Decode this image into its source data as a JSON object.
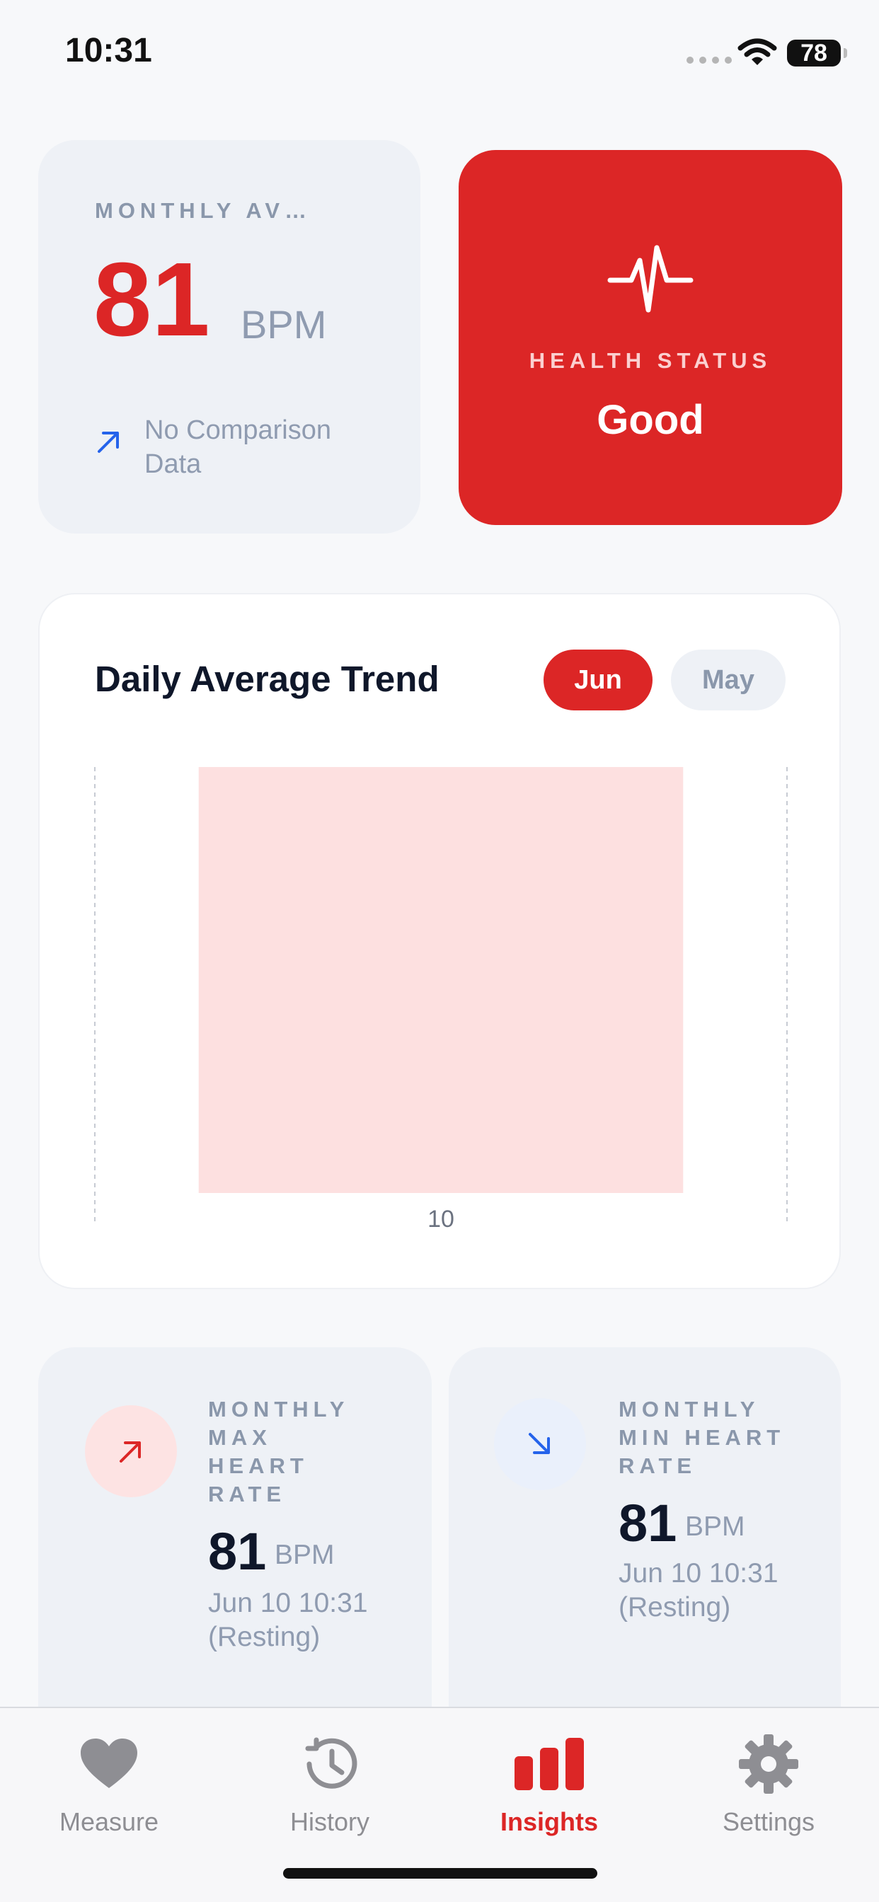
{
  "status_bar": {
    "time": "10:31",
    "battery": "78"
  },
  "monthly_average": {
    "label": "MONTHLY AV…",
    "value": "81",
    "unit": "BPM",
    "comparison": "No Comparison Data",
    "trend_icon": "arrow-up-right-icon"
  },
  "health_status": {
    "icon": "pulse-icon",
    "label": "HEALTH STATUS",
    "value": "Good"
  },
  "trend": {
    "title": "Daily Average Trend",
    "segments": [
      {
        "label": "Jun",
        "selected": true
      },
      {
        "label": "May",
        "selected": false
      }
    ]
  },
  "chart_data": {
    "type": "bar",
    "categories": [
      "10"
    ],
    "values": [
      81
    ],
    "title": "Daily Average Trend",
    "xlabel": "",
    "ylabel": "",
    "bar_color": "#fde0e0",
    "grid": "vertical dashed"
  },
  "max_stat": {
    "label": "MONTHLY MAX HEART RATE",
    "value": "81",
    "unit": "BPM",
    "date": "Jun 10 10:31 (Resting)",
    "icon": "arrow-up-right-icon"
  },
  "min_stat": {
    "label": "MONTHLY MIN HEART RATE",
    "value": "81",
    "unit": "BPM",
    "date": "Jun 10 10:31 (Resting)",
    "icon": "arrow-down-right-icon"
  },
  "tabs": [
    {
      "label": "Measure",
      "icon": "heart-icon",
      "active": false
    },
    {
      "label": "History",
      "icon": "clock-history-icon",
      "active": false
    },
    {
      "label": "Insights",
      "icon": "bar-chart-icon",
      "active": true
    },
    {
      "label": "Settings",
      "icon": "gear-icon",
      "active": false
    }
  ],
  "colors": {
    "accent": "#dc2626",
    "muted": "#8f9bb0",
    "card": "#eef1f6",
    "blue": "#2563eb"
  }
}
